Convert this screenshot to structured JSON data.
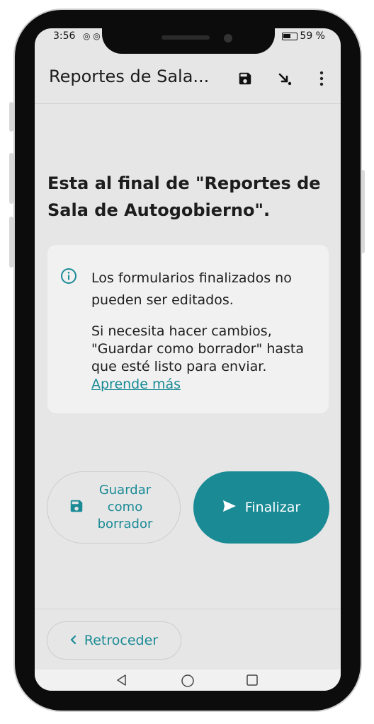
{
  "status_bar": {
    "time": "3:56",
    "notification_icons": "◎ ◎",
    "battery": "59 %"
  },
  "app_bar": {
    "title": "Reportes de Sala...",
    "actions": [
      "save-icon",
      "download-icon",
      "more-vert-icon"
    ]
  },
  "main": {
    "heading": "Esta al final de \"Reportes de Sala de Autogobierno\".",
    "info_card": {
      "icon": "info-icon",
      "text1": "Los formularios finalizados no pueden ser editados.",
      "text2": "Si necesita hacer cambios, \"Guardar como borrador\" hasta que esté listo para enviar.",
      "link": "Aprende más"
    },
    "buttons": {
      "save_draft": "Guardar como borrador",
      "finalize": "Finalizar"
    }
  },
  "footer": {
    "back": "Retroceder"
  },
  "navigation": [
    "back-nav-icon",
    "home-nav-icon",
    "recents-nav-icon"
  ],
  "colors": {
    "accent": "#1a8a95",
    "background": "#e6e6e6",
    "card": "#f1f1f1"
  }
}
